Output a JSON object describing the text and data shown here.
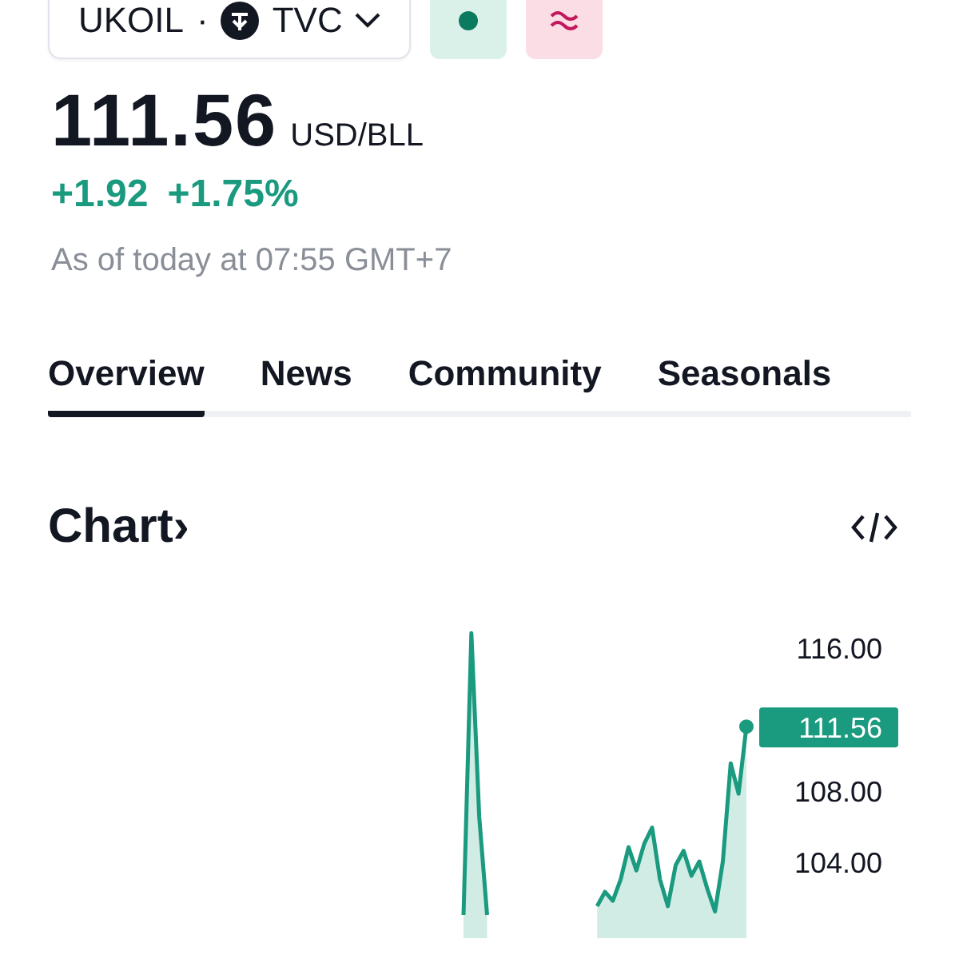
{
  "header": {
    "symbol": "UKOIL",
    "separator": "·",
    "exchange": "TVC"
  },
  "quote": {
    "price": "111.56",
    "unit": "USD/BLL",
    "change": "+1.92",
    "change_percent": "+1.75%",
    "timestamp": "As of today at 07:55 GMT+7"
  },
  "tabs": [
    {
      "label": "Overview",
      "selected": true
    },
    {
      "label": "News",
      "selected": false
    },
    {
      "label": "Community",
      "selected": false
    },
    {
      "label": "Seasonals",
      "selected": false
    }
  ],
  "chart": {
    "title": "Chart",
    "arrow": "›",
    "last_price_label": "111.56",
    "y_axis_labels": [
      "116.00",
      "108.00",
      "104.00"
    ]
  }
}
